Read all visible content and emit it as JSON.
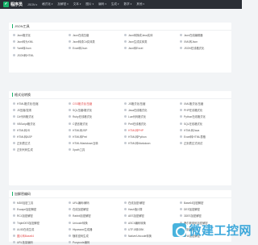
{
  "topbar": {
    "logo_text": "程序员",
    "nav": [
      {
        "label": "JSON",
        "caret": "▾"
      },
      {
        "label": "格式化",
        "caret": "▾"
      },
      {
        "label": "加解密",
        "caret": "▾"
      },
      {
        "label": "文本",
        "caret": "▾"
      },
      {
        "label": "图片",
        "caret": "▾"
      },
      {
        "label": "编码",
        "caret": "▾"
      },
      {
        "label": "生成",
        "caret": "▾"
      },
      {
        "label": "数学",
        "caret": "▾"
      },
      {
        "label": "其他",
        "caret": "▾"
      }
    ]
  },
  "sections": [
    {
      "title": "JSON工具",
      "items": [
        {
          "label": "Json格式化"
        },
        {
          "label": "Json在线压缩"
        },
        {
          "label": "Json转换成Java实体"
        },
        {
          "label": "Json在线编辑器"
        },
        {
          "label": "Json转为XML"
        },
        {
          "label": "Json转成C#实体类"
        },
        {
          "label": "Json生成实体类"
        },
        {
          "label": "XML转Json"
        },
        {
          "label": "Yaml转Json"
        },
        {
          "label": "Excel转Json"
        },
        {
          "label": "Json转Excel"
        },
        {
          "label": "JSON在线格式化"
        },
        {
          "label": "JSON转HTML"
        }
      ]
    },
    {
      "title": "格式化转换",
      "items": [
        {
          "label": "HTML格式化/压缩"
        },
        {
          "label": "CSS格式化/压缩",
          "red": true
        },
        {
          "label": "JS格式化/压缩"
        },
        {
          "label": "XML格式化/压缩"
        },
        {
          "label": "JS压缩/混淆"
        },
        {
          "label": "SQL压缩/格式化"
        },
        {
          "label": "Java在线格式化"
        },
        {
          "label": "PHP在线格式化"
        },
        {
          "label": "C#代码格式化"
        },
        {
          "label": "Ruby在线格式化"
        },
        {
          "label": "Lua代码格式化"
        },
        {
          "label": "Python在线格式化"
        },
        {
          "label": "VBScript格式化"
        },
        {
          "label": "C语言格式化"
        },
        {
          "label": "Perl在线格式化"
        },
        {
          "label": "SQL在线格式化"
        },
        {
          "label": "HTML转JS"
        },
        {
          "label": "HTML转JSP"
        },
        {
          "label": "HTML转PHP",
          "red": true
        },
        {
          "label": "HTML转Java"
        },
        {
          "label": "HTML转ASP"
        },
        {
          "label": "HTML转Perl"
        },
        {
          "label": "HTML转Python"
        },
        {
          "label": "Excel转HTML表格"
        },
        {
          "label": "正则表达式"
        },
        {
          "label": "HTML/Markdown互转"
        },
        {
          "label": "HTML转Markdown"
        },
        {
          "label": "正则表达式测试"
        },
        {
          "label": "正则代码生成"
        },
        {
          "label": "Xpath工具"
        }
      ]
    },
    {
      "title": "加解密编码",
      "items": [
        {
          "label": "MD5加密工具"
        },
        {
          "label": "URL编码/解码"
        },
        {
          "label": "在线加密/解密"
        },
        {
          "label": "Base64加密解密"
        },
        {
          "label": "Escape加密解密"
        },
        {
          "label": "在线加密解密"
        },
        {
          "label": "Hash值计算"
        },
        {
          "label": "DES加密解密"
        },
        {
          "label": "RC4加密解密"
        },
        {
          "label": "Rabbit加密解密"
        },
        {
          "label": "AES加密解密"
        },
        {
          "label": "3DES加密解密"
        },
        {
          "label": "TripleDES加密解密"
        },
        {
          "label": "Unicode转换"
        },
        {
          "label": "ASCII编码转换"
        },
        {
          "label": "摩尔斯电码加密解密"
        },
        {
          "label": "UUID在线生成"
        },
        {
          "label": "Htpasswd生成器"
        },
        {
          "label": "UTF-8转GBK"
        },
        {
          "label": "进制转换"
        },
        {
          "label": "图片转Base64",
          "red": true
        },
        {
          "label": "随机密码生成"
        },
        {
          "label": "Native/Unicode转换"
        },
        {
          "label": "SHA加密解密"
        },
        {
          "label": "URL批量编码"
        },
        {
          "label": "Punycode编码"
        }
      ]
    }
  ],
  "watermark": {
    "text": "微建工控网"
  }
}
